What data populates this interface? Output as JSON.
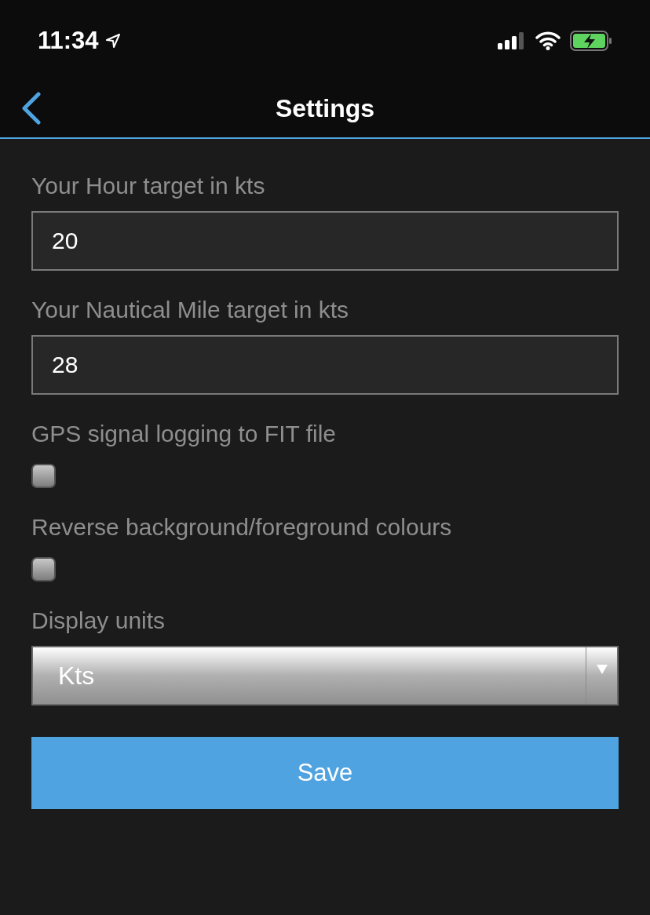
{
  "status_bar": {
    "time": "11:34"
  },
  "nav": {
    "title": "Settings"
  },
  "fields": [
    {
      "kind": "text",
      "label": "Your Hour target in kts",
      "value": "20"
    },
    {
      "kind": "text",
      "label": "Your Nautical Mile target in kts",
      "value": "28"
    },
    {
      "kind": "checkbox",
      "label": "GPS signal logging to FIT file",
      "checked": false
    },
    {
      "kind": "checkbox",
      "label": "Reverse background/foreground colours",
      "checked": false
    },
    {
      "kind": "select",
      "label": "Display units",
      "value": "Kts"
    }
  ],
  "save_button": "Save"
}
